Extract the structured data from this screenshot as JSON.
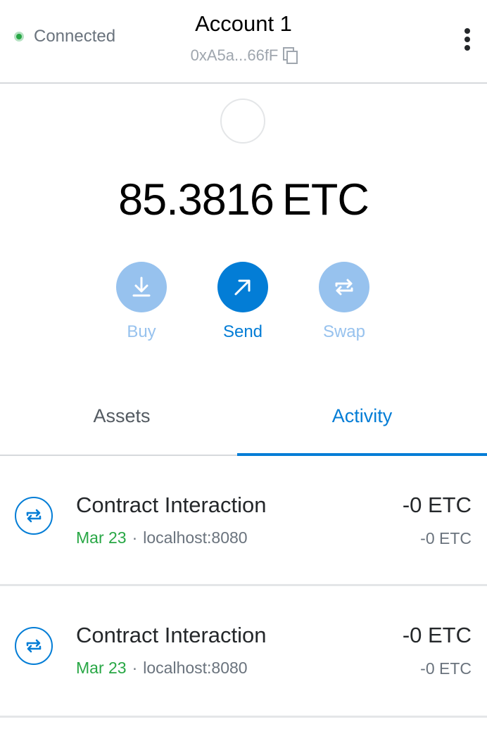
{
  "header": {
    "status": "Connected",
    "account_name": "Account 1",
    "address": "0xA5a...66fF",
    "status_color": "#28a745"
  },
  "balance": {
    "amount": "85.3816",
    "unit": "ETC"
  },
  "actions": {
    "buy": "Buy",
    "send": "Send",
    "swap": "Swap"
  },
  "tabs": {
    "assets": "Assets",
    "activity": "Activity",
    "selected": "Activity",
    "accent_color": "#037dd6"
  },
  "transactions": [
    {
      "title": "Contract Interaction",
      "date": "Mar 23",
      "separator": "·",
      "origin": "localhost:8080",
      "amount": "-0 ETC",
      "secondary_amount": "-0 ETC",
      "icon": "swap-arrows-icon"
    },
    {
      "title": "Contract Interaction",
      "date": "Mar 23",
      "separator": "·",
      "origin": "localhost:8080",
      "amount": "-0 ETC",
      "secondary_amount": "-0 ETC",
      "icon": "swap-arrows-icon"
    }
  ]
}
